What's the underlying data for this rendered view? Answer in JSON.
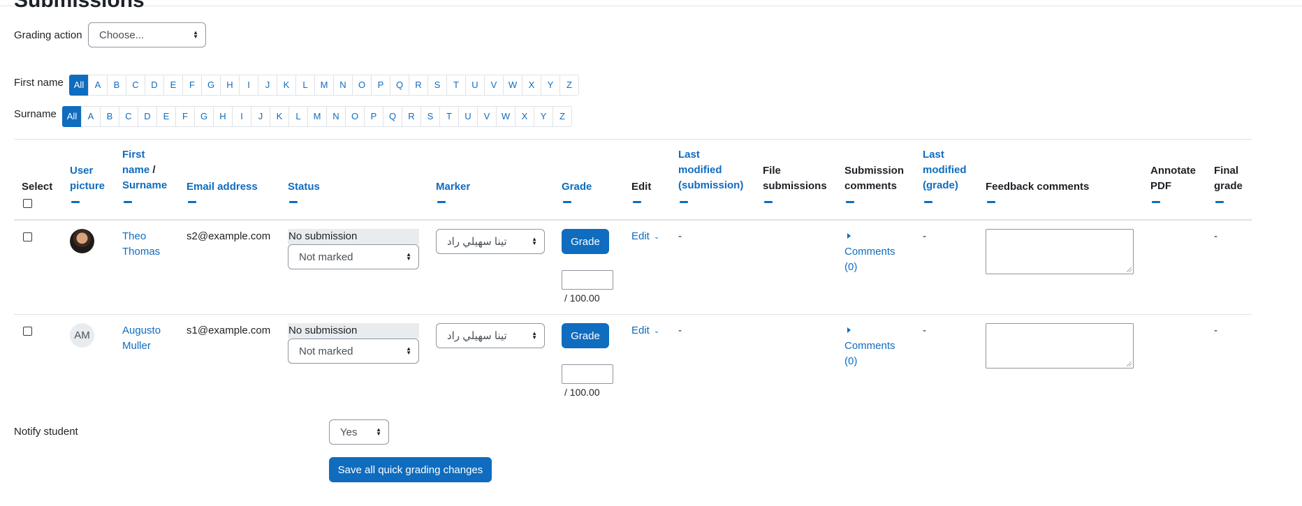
{
  "page": {
    "title": "Submissions"
  },
  "grading_action": {
    "label": "Grading action",
    "selected": "Choose..."
  },
  "initials": {
    "first_name_label": "First name",
    "surname_label": "Surname",
    "letters": [
      "All",
      "A",
      "B",
      "C",
      "D",
      "E",
      "F",
      "G",
      "H",
      "I",
      "J",
      "K",
      "L",
      "M",
      "N",
      "O",
      "P",
      "Q",
      "R",
      "S",
      "T",
      "U",
      "V",
      "W",
      "X",
      "Y",
      "Z"
    ],
    "active": "All"
  },
  "table": {
    "headers": {
      "select": "Select",
      "user_picture_1": "User",
      "user_picture_2": "picture",
      "first_name_1": "First",
      "first_name_2": "name",
      "name_sep": " /",
      "surname": "Surname",
      "email": "Email address",
      "status": "Status",
      "marker": "Marker",
      "grade": "Grade",
      "edit": "Edit",
      "last_modified_sub_1": "Last",
      "last_modified_sub_2": "modified",
      "last_modified_sub_3": "(submission)",
      "file_submissions_1": "File",
      "file_submissions_2": "submissions",
      "submission_comments_1": "Submission",
      "submission_comments_2": "comments",
      "last_modified_grade_1": "Last",
      "last_modified_grade_2": "modified",
      "last_modified_grade_3": "(grade)",
      "feedback_comments": "Feedback comments",
      "annotate_pdf_1": "Annotate",
      "annotate_pdf_2": "PDF",
      "final_grade_1": "Final",
      "final_grade_2": "grade"
    },
    "rows": [
      {
        "first_name": "Theo",
        "surname": "Thomas",
        "email": "s2@example.com",
        "status": "No submission",
        "marking_state": "Not marked",
        "marker": "تينا سهيلي راد",
        "grade_button": "Grade",
        "grade_max": "/ 100.00",
        "edit": "Edit",
        "last_modified_submission": "-",
        "comments_1": "Comments",
        "comments_2": "(0)",
        "last_modified_grade": "-",
        "final_grade": "-",
        "avatar": "photo"
      },
      {
        "first_name": "Augusto",
        "surname": "Muller",
        "email": "s1@example.com",
        "status": "No submission",
        "marking_state": "Not marked",
        "marker": "تينا سهيلي راد",
        "grade_button": "Grade",
        "grade_max": "/ 100.00",
        "edit": "Edit",
        "last_modified_submission": "-",
        "comments_1": "Comments",
        "comments_2": "(0)",
        "last_modified_grade": "-",
        "final_grade": "-",
        "avatar_initials": "AM"
      }
    ]
  },
  "notify": {
    "label": "Notify student",
    "selected": "Yes"
  },
  "save_button": "Save all quick grading changes",
  "colors": {
    "primary": "#0f6cbf",
    "text": "#1d2125",
    "border": "#dee2e6"
  }
}
